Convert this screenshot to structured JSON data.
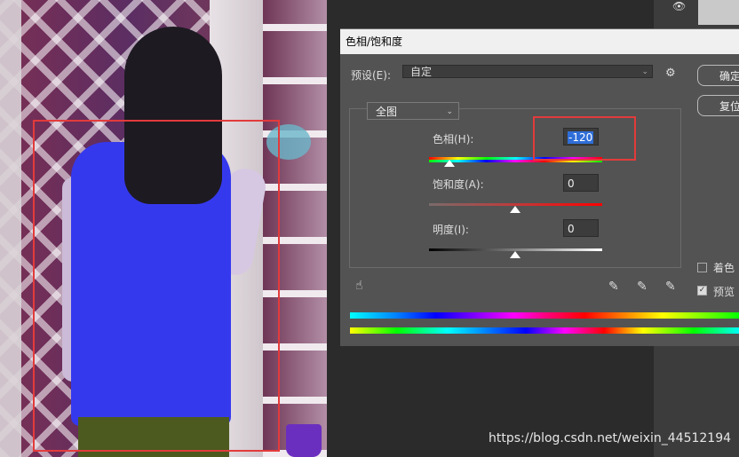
{
  "dialog": {
    "title": "色相/饱和度",
    "preset_label": "预设(E):",
    "preset_value": "自定",
    "ok_label": "确定",
    "reset_label": "复位",
    "channel_value": "全图",
    "hue_label": "色相(H):",
    "hue_value": "-120",
    "saturation_label": "饱和度(A):",
    "saturation_value": "0",
    "lightness_label": "明度(I):",
    "lightness_value": "0",
    "colorize_label": "着色",
    "colorize_checked": false,
    "preview_label": "预览",
    "preview_checked": true
  },
  "watermark": "https://blog.csdn.net/weixin_44512194",
  "colors": {
    "annotation_red": "#e33b3b",
    "dialog_bg": "#535353",
    "selection_blue": "#2f6ed8"
  },
  "icons": {
    "preset_gear": "gear-icon",
    "hand_tool": "hand-adjust-icon",
    "eyedropper": "eyedropper-icon",
    "eyedropper_plus": "eyedropper-plus-icon",
    "eyedropper_minus": "eyedropper-minus-icon",
    "layer_visibility": "eye-icon"
  }
}
